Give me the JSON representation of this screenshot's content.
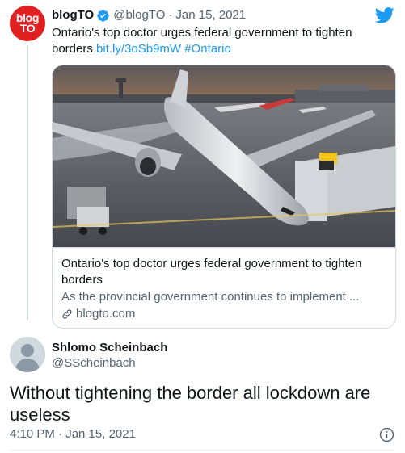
{
  "quoted_tweet": {
    "avatar_text_line1": "blog",
    "avatar_text_line2": "TO",
    "author_name": "blogTO",
    "author_handle": "@blogTO",
    "separator": "·",
    "date": "Jan 15, 2021",
    "text": "Ontario's top doctor urges federal government to tighten borders",
    "short_link": "bit.ly/3oSb9mW",
    "hashtag": "#Ontario",
    "card": {
      "title": "Ontario's top doctor urges federal government to tighten borders",
      "description": "As the provincial government continues to implement ...",
      "domain": "blogto.com",
      "image_icon": "airplane-at-gate-photo"
    }
  },
  "main_tweet": {
    "author_name": "Shlomo Scheinbach",
    "author_handle": "@SScheinbach",
    "text": "Without tightening the border all lockdown are useless",
    "timestamp": "4:10 PM · Jan 15, 2021"
  },
  "icons": {
    "verified": "verified-badge-icon",
    "brand": "twitter-bird-icon",
    "link": "link-icon",
    "info": "info-icon"
  },
  "colors": {
    "brand_blue": "#1d9bf0",
    "blogto_red": "#e02020",
    "text_primary": "#0f1419",
    "text_secondary": "#536471"
  }
}
